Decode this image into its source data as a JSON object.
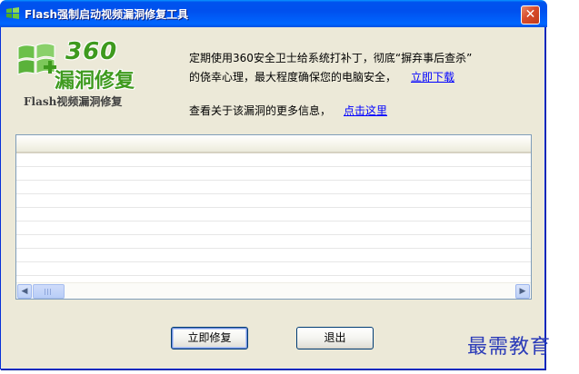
{
  "window": {
    "title": "Flash强制启动视频漏洞修复工具",
    "close_label": "✕"
  },
  "logo": {
    "brand_number": "360",
    "brand_text": "漏洞修复",
    "subtitle": "Flash视频漏洞修复"
  },
  "info": {
    "line1": "定期使用360安全卫士给系统打补丁，彻底“摒弃事后查杀”",
    "line2": "的侥幸心理，最大程度确保您的电脑安全，",
    "download_link": "立即下载",
    "line3": "查看关于该漏洞的更多信息，",
    "more_link": "点击这里"
  },
  "list": {
    "columns": [],
    "rows": []
  },
  "buttons": {
    "fix": "立即修复",
    "exit": "退出"
  },
  "watermark": "最需教育",
  "colors": {
    "titlebar": "#0054e3",
    "window_bg": "#ece9d8",
    "link": "#0000ff",
    "logo_green": "#3e9a1e",
    "watermark": "#2b3bb8"
  }
}
